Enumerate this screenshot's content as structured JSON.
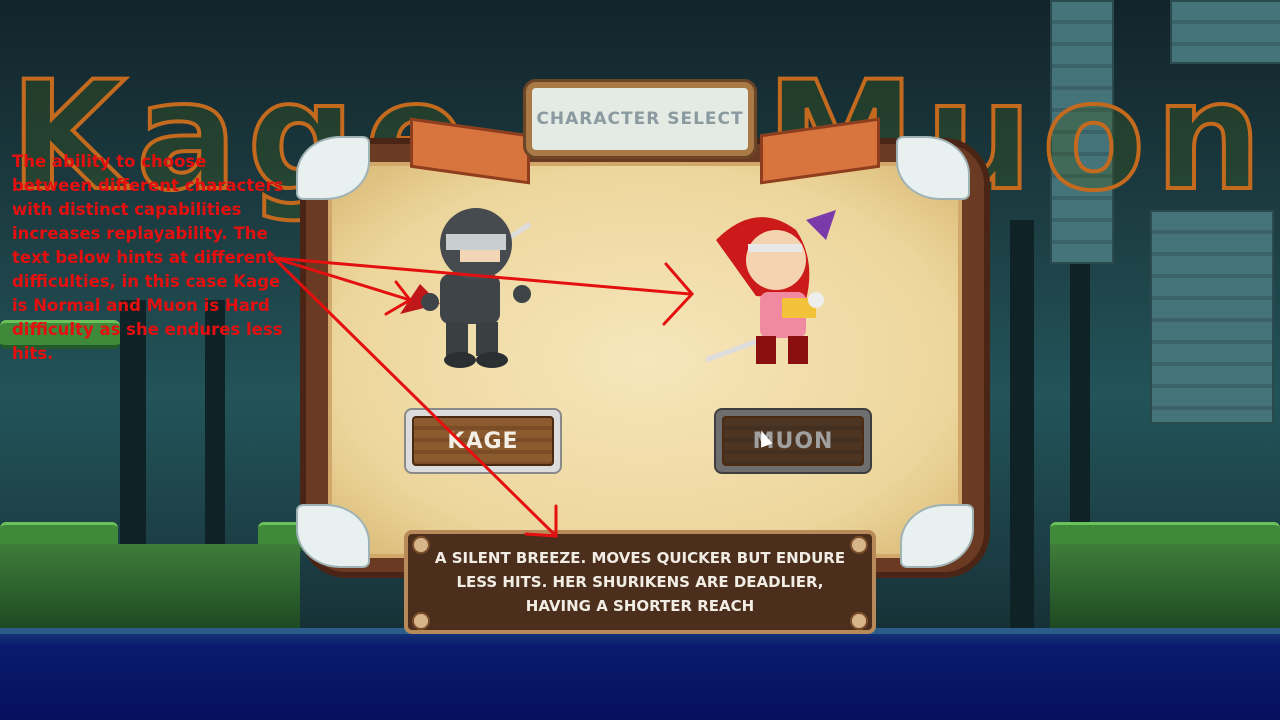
{
  "game_title_left": "Kage",
  "game_title_right": "Muon",
  "panel": {
    "title": "CHARACTER SELECT"
  },
  "characters": [
    {
      "name": "KAGE",
      "selected": false
    },
    {
      "name": "MUON",
      "selected": true
    }
  ],
  "description": "A SILENT BREEZE. MOVES QUICKER BUT ENDURE LESS HITS. HER SHURIKENS ARE DEADLIER, HAVING A SHORTER REACH",
  "annotation": "The ability to choose between different characters with distinct capabilities increases replayability. The text below hints at different difficulties, in this case Kage is Normal and Muon is Hard difficulty as she endures less hits.",
  "colors": {
    "annotation": "#e41010",
    "frame": "#6b3a22",
    "parchment": "#f6e6bb",
    "water": "#050f5e"
  },
  "icons": [
    "cursor-icon"
  ]
}
